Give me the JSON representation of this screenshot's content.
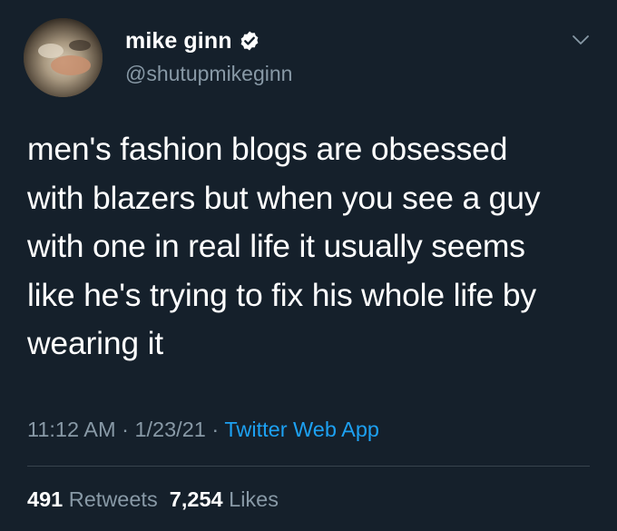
{
  "author": {
    "display_name": "mike ginn",
    "handle": "@shutupmikeginn",
    "verified": true
  },
  "tweet": {
    "text": "men's fashion blogs are obsessed\nwith blazers but when you see a guy\nwith one in real life it usually seems\nlike he's trying to fix his whole life by\nwearing it"
  },
  "meta": {
    "time": "11:12 AM",
    "separator": " · ",
    "date": "1/23/21",
    "source": "Twitter Web App"
  },
  "stats": {
    "retweets_count": "491",
    "retweets_label": "Retweets",
    "likes_count": "7,254",
    "likes_label": "Likes"
  },
  "icons": {
    "verified": "verified-badge-icon",
    "more": "chevron-down-icon"
  },
  "colors": {
    "background": "#15202b",
    "text_primary": "#ffffff",
    "text_secondary": "#8899a6",
    "accent": "#1da1f2",
    "divider": "#38444d"
  }
}
